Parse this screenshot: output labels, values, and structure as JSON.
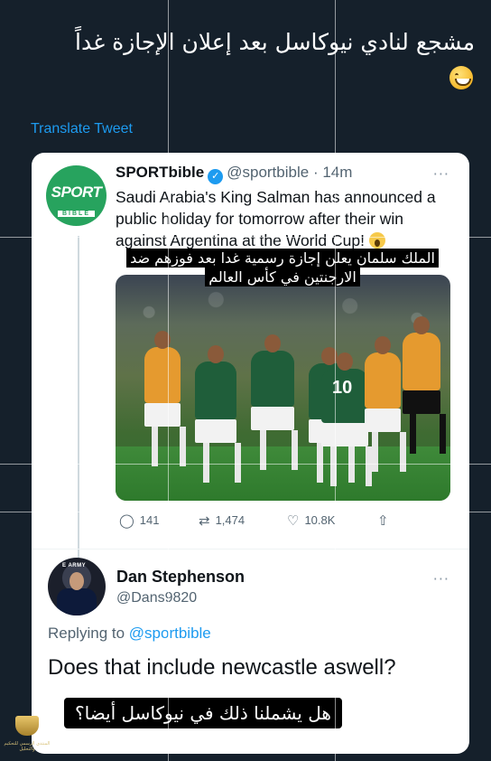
{
  "caption": "مشجع لنادي نيوكاسل بعد إعلان الإجازة غداً",
  "translate_label": "Translate Tweet",
  "quoted_tweet": {
    "account_name": "SPORTbible",
    "logo_line1": "SPORT",
    "logo_line2": "BIBLE",
    "handle": "@sportbible",
    "separator": "·",
    "time": "14m",
    "more": "···",
    "text": "Saudi Arabia's King Salman has announced a public holiday for tomorrow after their win against Argentina at the World Cup!",
    "arabic_overlay_line1": "الملك سلمان يعلن إجازة رسمية غدا بعد فوزهم ضد",
    "arabic_overlay_line2": "الارجنتين في كأس العالم",
    "jersey_number": "10",
    "replies": "141",
    "retweets": "1,474",
    "likes": "10.8K",
    "icons": [
      "comment-icon",
      "retweet-icon",
      "like-icon",
      "share-icon"
    ]
  },
  "reply_tweet": {
    "name": "Dan Stephenson",
    "handle": "@Dans9820",
    "more": "···",
    "avatar_text": "E ARMY",
    "replying_prefix": "Replying to",
    "replying_to": "@sportbible",
    "text": "Does that include newcastle aswell?",
    "arabic_translation": "هل يشملنا ذلك في نيوكاسل أيضا؟"
  },
  "watermark_text": "المنتدى الرسمي للتحكيم والتحليل",
  "colors": {
    "background": "#15202b",
    "link": "#1d9bf0",
    "card": "#ffffff",
    "muted_text": "#536471",
    "sportbible_green": "#27a35e"
  }
}
